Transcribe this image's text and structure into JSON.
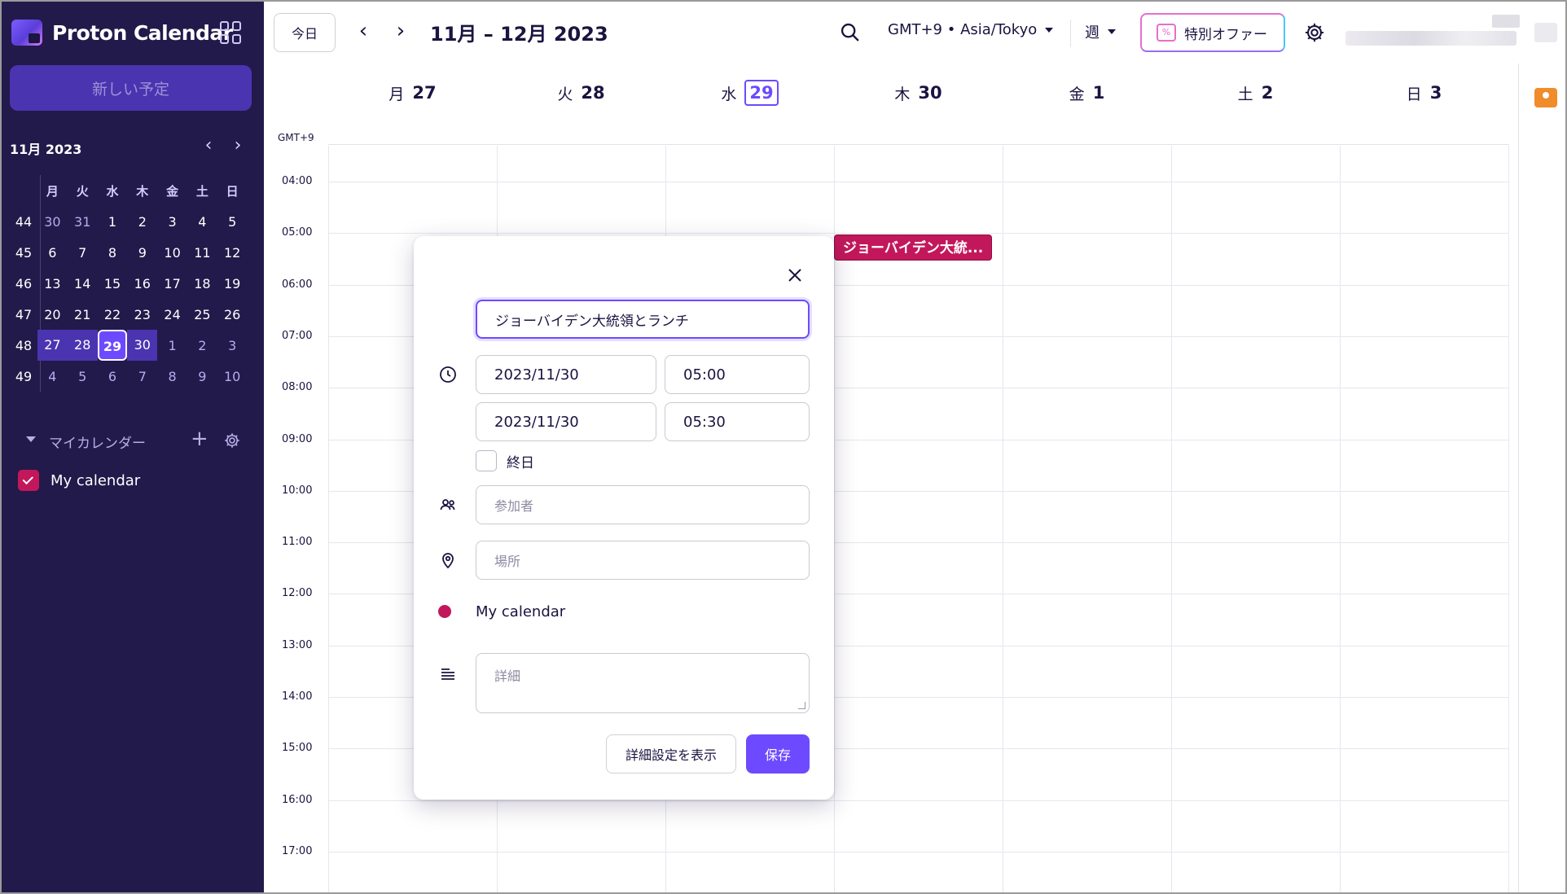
{
  "app": {
    "name": "Proton Calendar"
  },
  "sidebar": {
    "new_event_label": "新しい予定",
    "mini_calendar": {
      "title": "11月 2023",
      "weekday_headers": [
        "月",
        "火",
        "水",
        "木",
        "金",
        "土",
        "日"
      ],
      "weeks": [
        {
          "week": "44",
          "days": [
            "30",
            "31",
            "1",
            "2",
            "3",
            "4",
            "5"
          ]
        },
        {
          "week": "45",
          "days": [
            "6",
            "7",
            "8",
            "9",
            "10",
            "11",
            "12"
          ]
        },
        {
          "week": "46",
          "days": [
            "13",
            "14",
            "15",
            "16",
            "17",
            "18",
            "19"
          ]
        },
        {
          "week": "47",
          "days": [
            "20",
            "21",
            "22",
            "23",
            "24",
            "25",
            "26"
          ]
        },
        {
          "week": "48",
          "days": [
            "27",
            "28",
            "29",
            "30",
            "1",
            "2",
            "3"
          ]
        },
        {
          "week": "49",
          "days": [
            "4",
            "5",
            "6",
            "7",
            "8",
            "9",
            "10"
          ]
        }
      ],
      "selected_week": "48",
      "today": "29"
    },
    "my_calendars_label": "マイカレンダー",
    "calendars": [
      {
        "name": "My calendar",
        "color": "#c2185b",
        "checked": true
      }
    ]
  },
  "toolbar": {
    "today_label": "今日",
    "range_title": "11月 – 12月 2023",
    "timezone_label": "GMT+9 • Asia/Tokyo",
    "view_label": "週",
    "offer_label": "特別オファー"
  },
  "week_view": {
    "tz_short": "GMT+9",
    "days": [
      {
        "dow": "月",
        "num": "27",
        "today": false
      },
      {
        "dow": "火",
        "num": "28",
        "today": false
      },
      {
        "dow": "水",
        "num": "29",
        "today": true
      },
      {
        "dow": "木",
        "num": "30",
        "today": false
      },
      {
        "dow": "金",
        "num": "1",
        "today": false
      },
      {
        "dow": "土",
        "num": "2",
        "today": false
      },
      {
        "dow": "日",
        "num": "3",
        "today": false
      }
    ],
    "hours": [
      "04:00",
      "05:00",
      "06:00",
      "07:00",
      "08:00",
      "09:00",
      "10:00",
      "11:00",
      "12:00",
      "13:00",
      "14:00",
      "15:00",
      "16:00",
      "17:00"
    ],
    "event_chip": {
      "label": "ジョーバイデン大統...",
      "color": "#c2185b"
    }
  },
  "event_form": {
    "title_value": "ジョーバイデン大統領とランチ",
    "start_date": "2023/11/30",
    "start_time": "05:00",
    "end_date": "2023/11/30",
    "end_time": "05:30",
    "all_day_label": "終日",
    "participants_placeholder": "参加者",
    "location_placeholder": "場所",
    "calendar_name": "My calendar",
    "description_placeholder": "詳細",
    "advanced_label": "詳細設定を表示",
    "save_label": "保存"
  },
  "colors": {
    "sidebar_bg": "#221a4a",
    "accent": "#6d4aff",
    "calendar_color": "#c2185b"
  }
}
